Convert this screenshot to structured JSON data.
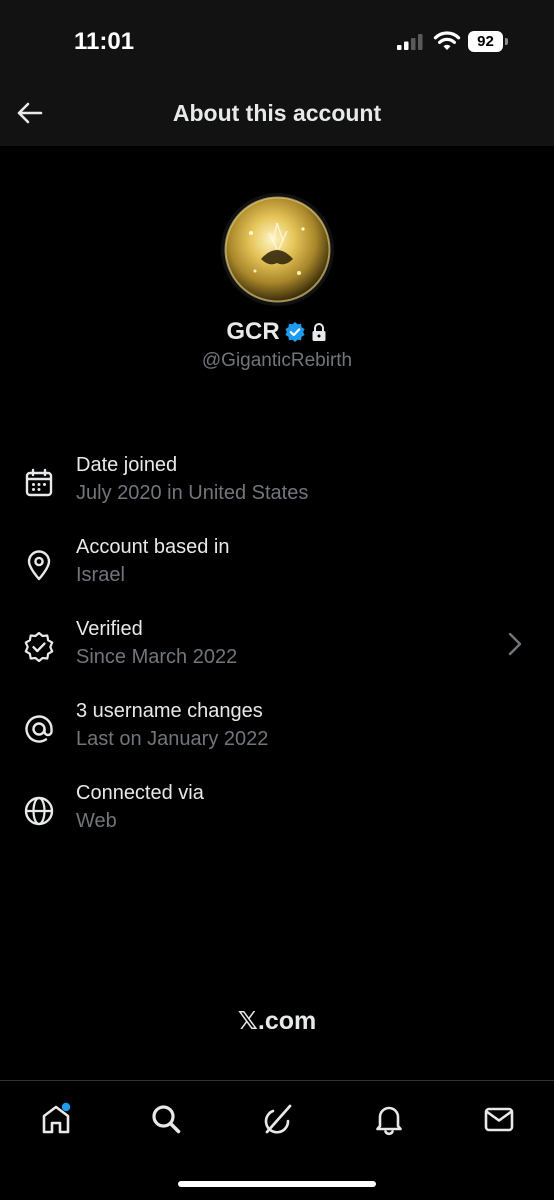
{
  "status_bar": {
    "time": "11:01",
    "battery": "92",
    "icons": [
      "signal-icon",
      "wifi-icon",
      "battery-icon"
    ]
  },
  "header": {
    "title": "About this account",
    "back_icon": "arrow-left-icon"
  },
  "profile": {
    "display_name": "GCR",
    "handle": "@GiganticRebirth",
    "badges": [
      "verified-badge-icon",
      "lock-icon"
    ],
    "verified_color": "#1d9bf0"
  },
  "info": [
    {
      "icon": "calendar-icon",
      "title": "Date joined",
      "subtitle": "July 2020 in United States"
    },
    {
      "icon": "location-pin-icon",
      "title": "Account based in",
      "subtitle": "Israel"
    },
    {
      "icon": "verified-check-icon",
      "title": "Verified",
      "subtitle": "Since March 2022",
      "has_chevron": true
    },
    {
      "icon": "at-sign-icon",
      "title": "3 username changes",
      "subtitle": "Last on January 2022"
    },
    {
      "icon": "globe-icon",
      "title": "Connected via",
      "subtitle": "Web"
    }
  ],
  "footer": {
    "brand": "𝕏.com"
  },
  "tab_bar": {
    "tabs": [
      "home-icon",
      "search-icon",
      "grok-icon",
      "notifications-icon",
      "messages-icon"
    ],
    "notification_dot_color": "#1d9bf0"
  },
  "colors": {
    "background": "#000000",
    "header_bg": "#121212",
    "primary_text": "#e7e9ea",
    "secondary_text": "#71767b",
    "accent": "#1d9bf0"
  }
}
